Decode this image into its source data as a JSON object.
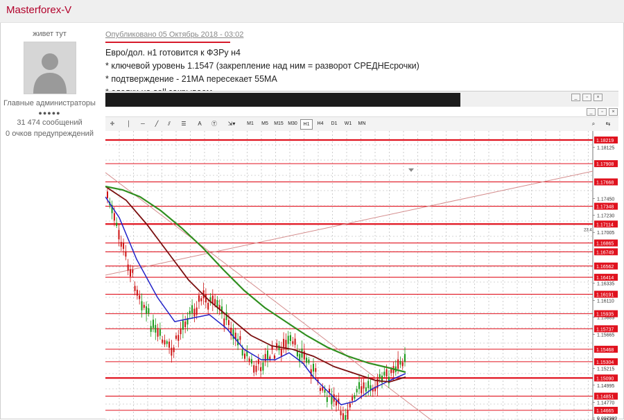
{
  "header": {
    "forum_user": "Masterforex-V"
  },
  "sidebar": {
    "status": "живет тут",
    "role": "Главные администраторы",
    "stars": "●●●●●",
    "messages": "31 474 сообщений",
    "warnings": "0 очков предупреждений"
  },
  "post": {
    "date": "Опубликовано 05 Октябрь 2018 - 03:02",
    "lines": [
      "Евро/дол. н1 готовится к ФЗРу н4",
      "* ключевой уровень 1.1547 (закрепление над ним = разворот СРЕДНЕсрочки)",
      "* подтверждение - 21МА пересекает 55МА",
      "* сделки на sell закрываем"
    ]
  },
  "terminal": {
    "tool_text": "A",
    "timeframes": [
      "M1",
      "M5",
      "M15",
      "M30",
      "H1",
      "H4",
      "D1",
      "W1",
      "MN"
    ],
    "active_timeframe": "H1"
  },
  "chart_data": {
    "type": "line",
    "title": "",
    "ylim": [
      1.14545,
      1.8219
    ],
    "price_scale_labels": [
      "1.18125",
      "1.17450",
      "1.17230",
      "1.17005",
      "1.16335",
      "1.16110",
      "1.15889",
      "1.15665",
      "1.15215",
      "1.14995",
      "1.14770",
      "1.14545",
      "0.007999"
    ],
    "level_labels": [
      "1.18219",
      "1.17908",
      "1.17668",
      "1.17348",
      "1.17114",
      "1.16865",
      "1.16749",
      "1.16562",
      "1.16414",
      "1.16191",
      "1.15935",
      "1.15737",
      "1.15468",
      "1.15304",
      "1.15090",
      "1.14851",
      "1.14665"
    ],
    "crosshair_label": "23.4",
    "colors": {
      "levels": "#e0121e",
      "ma_fast": "#2121c8",
      "ma_mid": "#7a0f0f",
      "ma_slow": "#2f8f1f",
      "trend": "#d48c8c"
    }
  }
}
